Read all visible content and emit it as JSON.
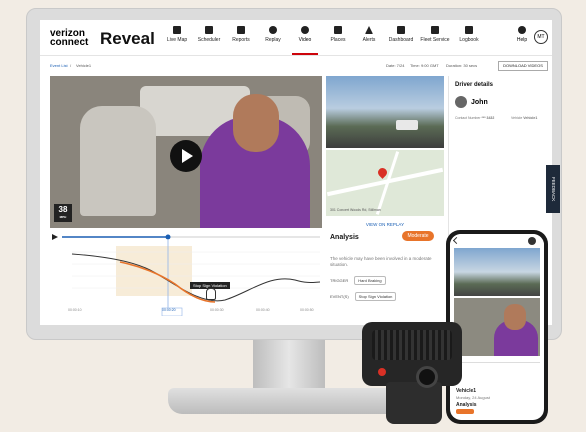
{
  "nav": {
    "brand_top": "verizon",
    "brand_bottom": "connect",
    "brand_product": "Reveal",
    "items": [
      {
        "label": "Live Map"
      },
      {
        "label": "Scheduler"
      },
      {
        "label": "Reports"
      },
      {
        "label": "Replay"
      },
      {
        "label": "Video",
        "active": true
      },
      {
        "label": "Places"
      },
      {
        "label": "Alerts"
      },
      {
        "label": "Dashboard"
      },
      {
        "label": "Fleet Service"
      },
      {
        "label": "Logbook"
      }
    ],
    "help_label": "Help",
    "avatar_initials": "MT"
  },
  "subheader": {
    "breadcrumb_root": "Event List",
    "breadcrumb_sep": "/",
    "breadcrumb_item": "Vehicle1",
    "date_label": "Date: 7/24",
    "time_label": "Time: 9:00 GMT",
    "duration_label": "Duration: 30 secs",
    "download_button": "DOWNLOAD VIDEOS"
  },
  "video": {
    "speed_value": "38",
    "speed_unit": "MPH"
  },
  "map": {
    "caption": "301 Concert Woods Rd, Stillman",
    "view_replay": "VIEW ON REPLAY"
  },
  "timeline": {
    "tooltip": "Stop Sign Violation",
    "time_labels": [
      "00:00:10",
      "00:00:20",
      "00:00:30",
      "00:00:40",
      "00:00:50"
    ]
  },
  "analysis": {
    "title": "Analysis",
    "badge": "Moderate",
    "description": "The vehicle may have been involved in a moderate situation.",
    "trigger_label": "TRIGGER",
    "trigger_value": "Hard Braking",
    "events_label": "EVENT(S)",
    "events_value": "Stop Sign Violation"
  },
  "driver": {
    "title": "Driver details",
    "name": "John",
    "contact_label": "Contact Number",
    "contact_value": "*** 3432",
    "vehicle_label": "Vehicle",
    "vehicle_value": "Vehicle1"
  },
  "feedback": "FEEDBACK",
  "phone": {
    "title": "Vehicle1",
    "subtitle": "Monday, 24 August",
    "section": "Analysis"
  },
  "colors": {
    "brand_red": "#cd040b",
    "accent_orange": "#e8742a",
    "link_blue": "#1a5fb4"
  }
}
